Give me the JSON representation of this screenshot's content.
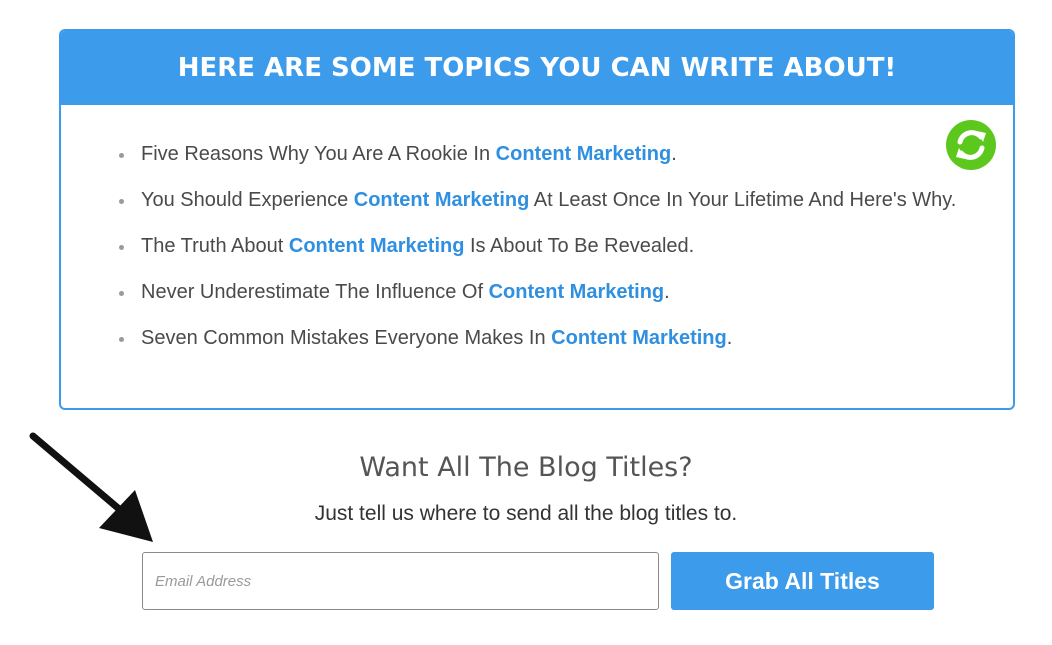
{
  "topics_box": {
    "heading": "HERE ARE SOME TOPICS YOU CAN WRITE ABOUT!",
    "refresh_icon": "refresh-icon",
    "items": [
      {
        "before": "Five Reasons Why You Are A Rookie In ",
        "keyword": "Content Marketing",
        "after": "."
      },
      {
        "before": "You Should Experience ",
        "keyword": "Content Marketing",
        "after": " At Least Once In Your Lifetime And Here's Why."
      },
      {
        "before": "The Truth About ",
        "keyword": "Content Marketing",
        "after": " Is About To Be Revealed."
      },
      {
        "before": "Never Underestimate The Influence Of ",
        "keyword": "Content Marketing",
        "after": "."
      },
      {
        "before": "Seven Common Mistakes Everyone Makes In ",
        "keyword": "Content Marketing",
        "after": "."
      }
    ]
  },
  "signup": {
    "title": "Want All The Blog Titles?",
    "subtitle": "Just tell us where to send all the blog titles to.",
    "email_placeholder": "Email Address",
    "email_value": "",
    "button_label": "Grab All Titles"
  },
  "colors": {
    "accent_blue": "#3c9beb",
    "keyword_blue": "#2f8fe0",
    "refresh_green": "#5cc81e",
    "body_text": "#4a4a4a"
  }
}
